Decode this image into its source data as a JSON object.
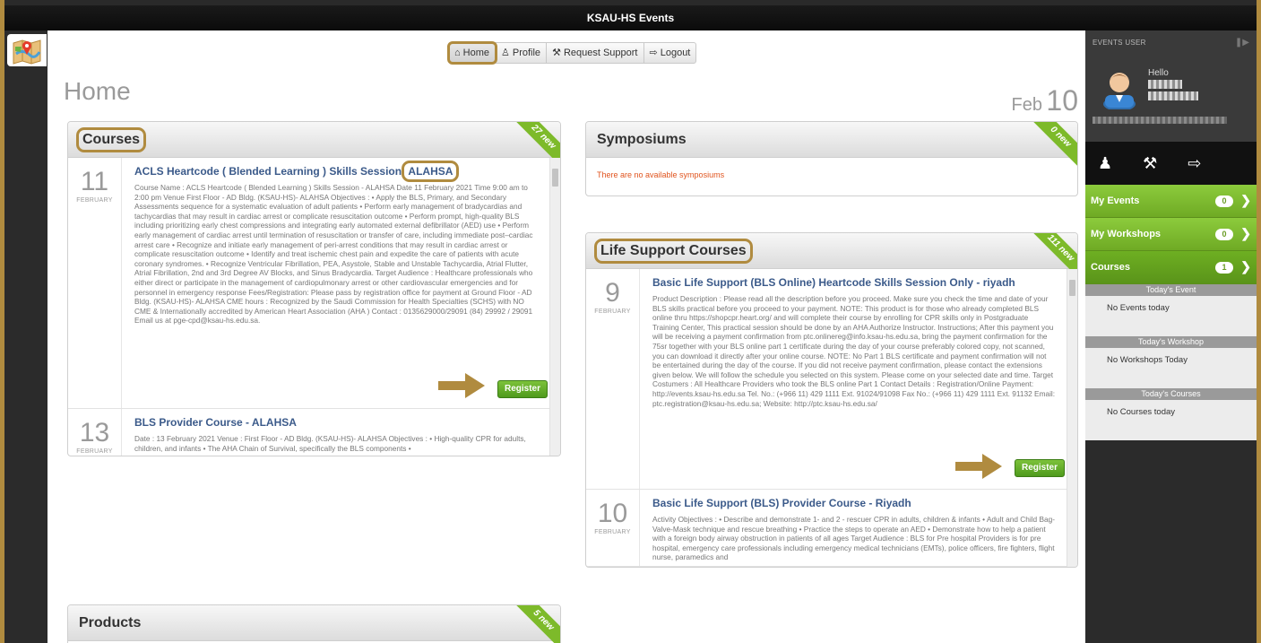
{
  "window": {
    "title": "KSAU-HS Events"
  },
  "nav": {
    "items": [
      "Home",
      "Profile",
      "Request Support",
      "Logout"
    ]
  },
  "page": {
    "title": "Home",
    "date_month": "Feb",
    "date_day": "10"
  },
  "courses": {
    "title": "Courses",
    "badge": "27 new",
    "entries": [
      {
        "day": "11",
        "month": "FEBRUARY",
        "title": "ACLS Heartcode ( Blended Learning ) Skills Session",
        "title_highlight": "ALAHSA",
        "description": "Course Name : ACLS Heartcode ( Blended Learning ) Skills Session - ALAHSA Date 11 February 2021 Time 9:00 am to 2:00 pm Venue First Floor - AD Bldg. (KSAU-HS)- ALAHSA Objectives : • Apply the BLS, Primary, and Secondary Assessments sequence for a systematic evaluation of adult patients • Perform early management of bradycardias and tachycardias that may result in cardiac arrest or complicate resuscitation outcome • Perform prompt, high-quality BLS including prioritizing early chest compressions and integrating early automated external defibrillator (AED) use • Perform early management of cardiac arrest until termination of resuscitation or transfer of care, including immediate post–cardiac arrest care • Recognize and initiate early management of peri-arrest conditions that may result in cardiac arrest or complicate resuscitation outcome • Identify and treat ischemic chest pain and expedite the care of patients with acute coronary syndromes. • Recognize Ventricular Fibrillation, PEA, Asystole, Stable and Unstable Tachycardia, Atrial Flutter, Atrial Fibrillation, 2nd and 3rd Degree AV Blocks, and Sinus Bradycardia. Target Audience : Healthcare professionals who either direct or participate in the management of cardiopulmonary arrest or other cardiovascular emergencies and for personnel in emergency response Fees/Registration: Please pass by registration office for payment at Ground Floor - AD Bldg. (KSAU-HS)- ALAHSA CME hours : Recognized by the Saudi Commission for Health Specialties (SCHS) with NO CME & Internationally accredited by American Heart Association (AHA ) Contact : 0135629000/29091 (84) 29992 / 29091 Email us at pge-cpd@ksau-hs.edu.sa.",
        "button": "Register"
      },
      {
        "day": "13",
        "month": "FEBRUARY",
        "title": "BLS Provider Course - ALAHSA",
        "description": "Date : 13 February 2021 Venue : First Floor - AD Bldg. (KSAU-HS)- ALAHSA Objectives : • High-quality CPR for adults, children, and infants • The AHA Chain of Survival, specifically the BLS components •"
      }
    ]
  },
  "symposiums": {
    "title": "Symposiums",
    "badge": "0 new",
    "empty": "There are no available symposiums"
  },
  "life_support": {
    "title": "Life Support Courses",
    "badge": "111 new",
    "entries": [
      {
        "day": "9",
        "month": "FEBRUARY",
        "title": "Basic Life Support (BLS Online) Heartcode Skills Session Only - riyadh",
        "description": "Product Description : Please read all the description before you proceed. Make sure you check the time and date of your BLS skills practical before you proceed to your payment. NOTE: This product is for those who already completed BLS online thru https://shopcpr.heart.org/ and will complete their course by enrolling for CPR skills only in Postgraduate Training Center, This practical session should be done by an AHA Authorize Instructor. Instructions; After this payment you will be receiving a payment confirmation from ptc.onlinereg@info.ksau-hs.edu.sa, bring the payment confirmation for the 75sr together with your BLS online part 1 certificate during the day of your course preferably colored copy, not scanned, you can download it directly after your online course. NOTE: No Part 1 BLS certificate and payment confirmation will not be entertained during the day of the course. If you did not receive payment confirmation, please contact the extensions given below. We will follow the schedule you selected on this system. Please come on your selected date and time. Target Costumers : All Healthcare Providers who took the BLS online Part 1 Contact Details : Registration/Online Payment: http://events.ksau-hs.edu.sa Tel. No.: (+966 11) 429 1111 Ext. 91024/91098 Fax No.: (+966 11) 429 1111 Ext. 91132 Email: ptc.registration@ksau-hs.edu.sa; Website: http://ptc.ksau-hs.edu.sa/",
        "button": "Register"
      },
      {
        "day": "10",
        "month": "FEBRUARY",
        "title": "Basic Life Support (BLS) Provider Course - Riyadh",
        "description": "Activity Objectives : • Describe and demonstrate 1- and 2 - rescuer CPR in adults, children & infants • Adult and Child Bag-Valve-Mask technique and rescue breathing • Practice the steps to operate an AED • Demonstrate how to help a patient with a foreign body airway obstruction in patients of all ages Target Audience : BLS for Pre hospital Providers is for pre hospital, emergency care professionals including emergency medical technicians (EMTs), police officers, fire fighters, flight nurse, paramedics and"
      }
    ]
  },
  "products": {
    "title": "Products",
    "badge": "5 new"
  },
  "sidebar": {
    "header": "EVENTS USER",
    "hello": "Hello",
    "menu": [
      {
        "label": "My Events",
        "count": "0"
      },
      {
        "label": "My Workshops",
        "count": "0"
      },
      {
        "label": "Courses",
        "count": "1"
      }
    ],
    "sections": [
      {
        "label": "Today's Event",
        "text": "No Events today"
      },
      {
        "label": "Today's Workshop",
        "text": "No Workshops Today"
      },
      {
        "label": "Today's Courses",
        "text": "No Courses today"
      }
    ]
  }
}
